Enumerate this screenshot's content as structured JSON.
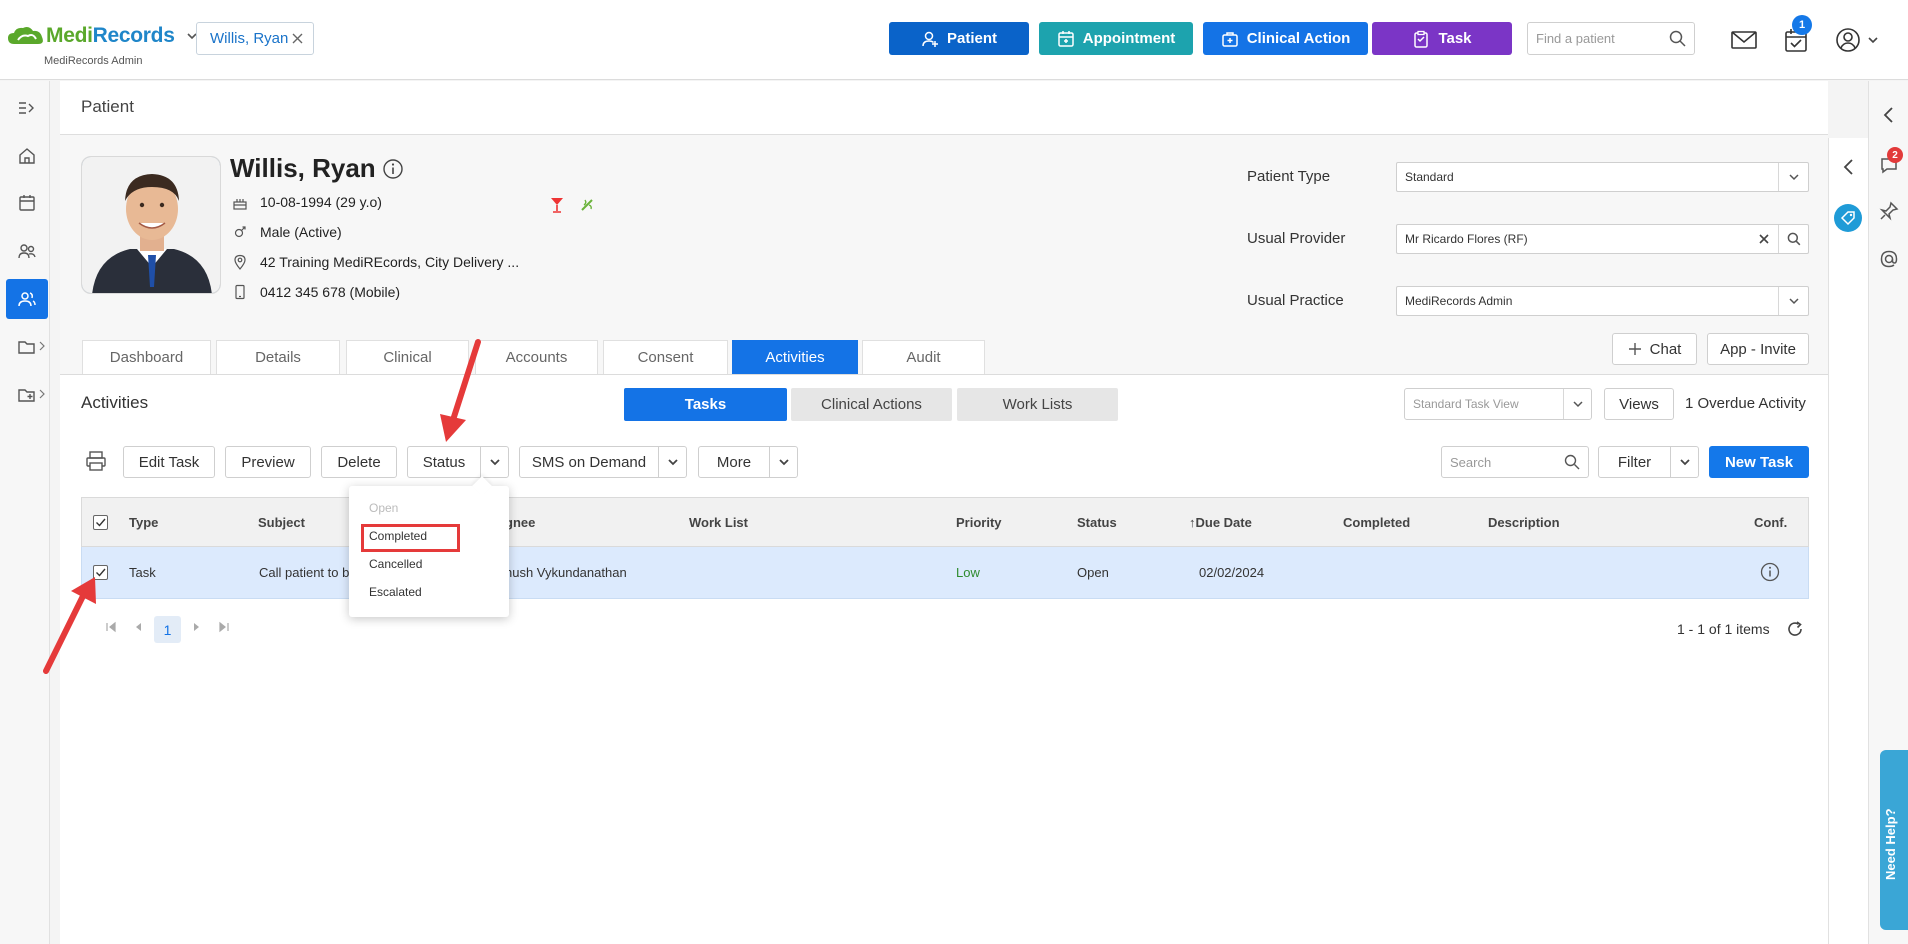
{
  "app": {
    "logo_medi": "Medi",
    "logo_records": "Records",
    "practice_name": "MediRecords Admin"
  },
  "header": {
    "patient_chip": "Willis, Ryan",
    "buttons": {
      "patient": "Patient",
      "appointment": "Appointment",
      "clinical_action": "Clinical Action",
      "task": "Task"
    },
    "find_placeholder": "Find a patient",
    "tasks_badge": "1"
  },
  "page": {
    "title": "Patient"
  },
  "patient": {
    "name": "Willis, Ryan",
    "dob": "10-08-1994 (29 y.o)",
    "gender": "Male (Active)",
    "address": "42 Training MediREcords, City Delivery ...",
    "phone": "0412 345 678 (Mobile)"
  },
  "fields": {
    "patient_type_label": "Patient Type",
    "patient_type_value": "Standard",
    "usual_provider_label": "Usual Provider",
    "usual_provider_value": "Mr Ricardo Flores (RF)",
    "usual_practice_label": "Usual Practice",
    "usual_practice_value": "MediRecords Admin"
  },
  "tabs": [
    "Dashboard",
    "Details",
    "Clinical",
    "Accounts",
    "Consent",
    "Activities",
    "Audit"
  ],
  "side_buttons": {
    "chat": "Chat",
    "app_invite": "App - Invite"
  },
  "activities": {
    "title": "Activities",
    "segments": [
      "Tasks",
      "Clinical Actions",
      "Work Lists"
    ],
    "view_placeholder": "Standard Task View",
    "views_button": "Views",
    "overdue": "1 Overdue Activity"
  },
  "toolbar": {
    "edit_task": "Edit Task",
    "preview": "Preview",
    "delete": "Delete",
    "status": "Status",
    "sms": "SMS on Demand",
    "more": "More",
    "search_placeholder": "Search",
    "filter": "Filter",
    "new_task": "New Task"
  },
  "grid": {
    "columns": [
      "Type",
      "Subject",
      "gnee",
      "Work List",
      "Priority",
      "Status",
      "Due Date",
      "Completed",
      "Description",
      "Conf."
    ],
    "rows": [
      {
        "type": "Task",
        "subject": "Call patient to b",
        "assignee": "nush Vykundanathan",
        "worklist": "",
        "priority": "Low",
        "status": "Open",
        "due": "02/02/2024",
        "completed": "",
        "description": ""
      }
    ],
    "page": "1",
    "items": "1 - 1 of 1 items"
  },
  "status_menu": {
    "options": [
      "Open",
      "Completed",
      "Cancelled",
      "Escalated"
    ]
  },
  "right_rail": {
    "chat_badge": "2",
    "need_help": "Need Help?"
  },
  "colors": {
    "primary": "#1473e6",
    "patient_btn": "#0a63c9",
    "appointment_btn": "#1da3ae",
    "task_btn": "#7b35c6",
    "annotation_red": "#e53a3a"
  }
}
